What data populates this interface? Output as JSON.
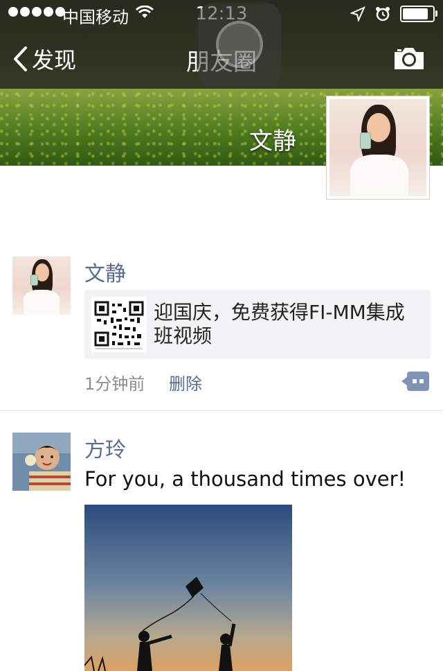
{
  "status_bar": {
    "carrier": "中国移动",
    "time": "12:13",
    "battery_level": 0.9
  },
  "nav": {
    "back_label": "发现",
    "title": "朋友圈",
    "camera_icon": "camera-icon"
  },
  "cover": {
    "user_name": "文静"
  },
  "posts": [
    {
      "author": "文静",
      "share_title": "迎国庆，免费获得FI-MM集成班视频",
      "time": "1分钟前",
      "delete_label": "删除"
    },
    {
      "author": "方玲",
      "text": "For you, a thousand times over!"
    }
  ],
  "colors": {
    "link": "#576b95",
    "nav_bg": "#2d3320"
  }
}
